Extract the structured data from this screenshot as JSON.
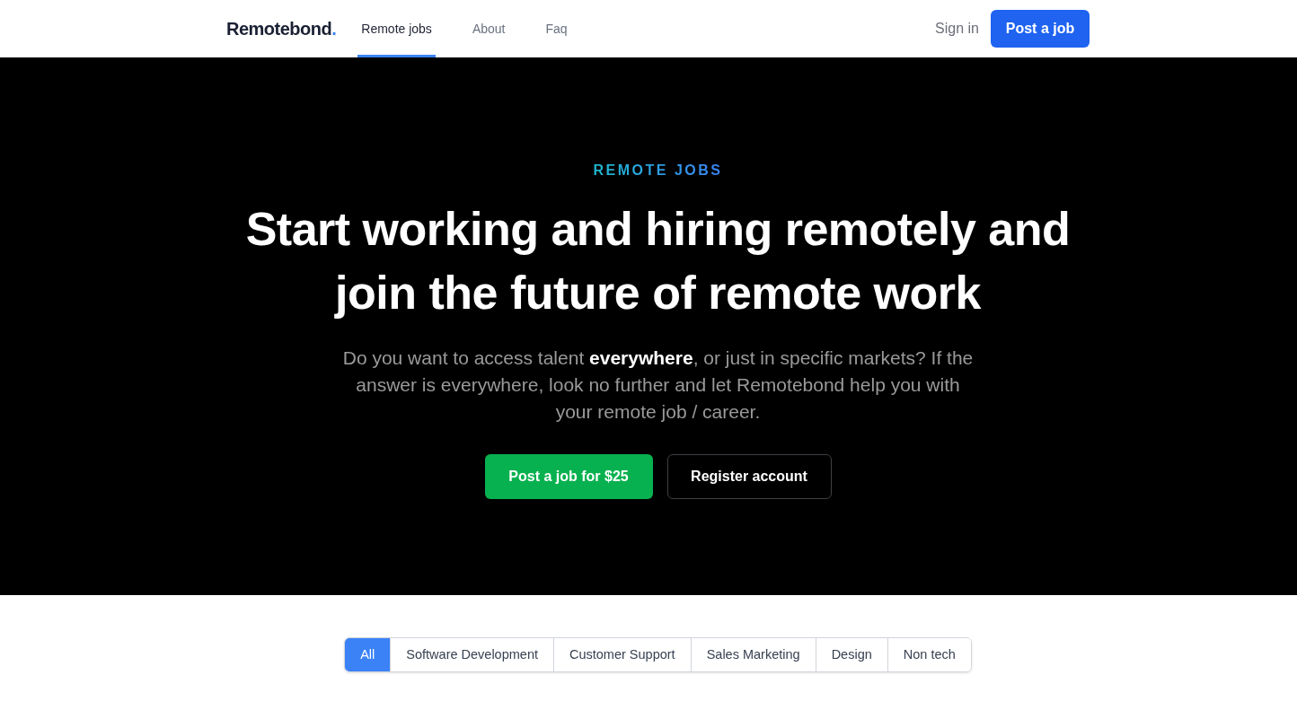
{
  "nav": {
    "logo": {
      "name": "Remotebond",
      "mark": "."
    },
    "links": [
      {
        "label": "Remote jobs",
        "selected": true
      },
      {
        "label": "About",
        "selected": false
      },
      {
        "label": "Faq",
        "selected": false
      }
    ],
    "sign_in": "Sign in",
    "post_button": "Post a job"
  },
  "hero": {
    "eyebrow": "REMOTE JOBS",
    "heading": "Start working and hiring remotely and join the future of remote work",
    "description": "Do you want to access talent **everywhere**, or just in specific markets? If the answer is everywhere, look no further and let Remotebond help you with your remote job / career.",
    "buttons": [
      {
        "label": "Post a job for $25",
        "kind": "primary"
      },
      {
        "label": "Register account",
        "kind": "outline"
      }
    ]
  },
  "categories": [
    {
      "label": "All",
      "selected": true
    },
    {
      "label": "Software Development",
      "selected": false
    },
    {
      "label": "Customer Support",
      "selected": false
    },
    {
      "label": "Sales Marketing",
      "selected": false
    },
    {
      "label": "Design",
      "selected": false
    },
    {
      "label": "Non tech",
      "selected": false
    }
  ]
}
